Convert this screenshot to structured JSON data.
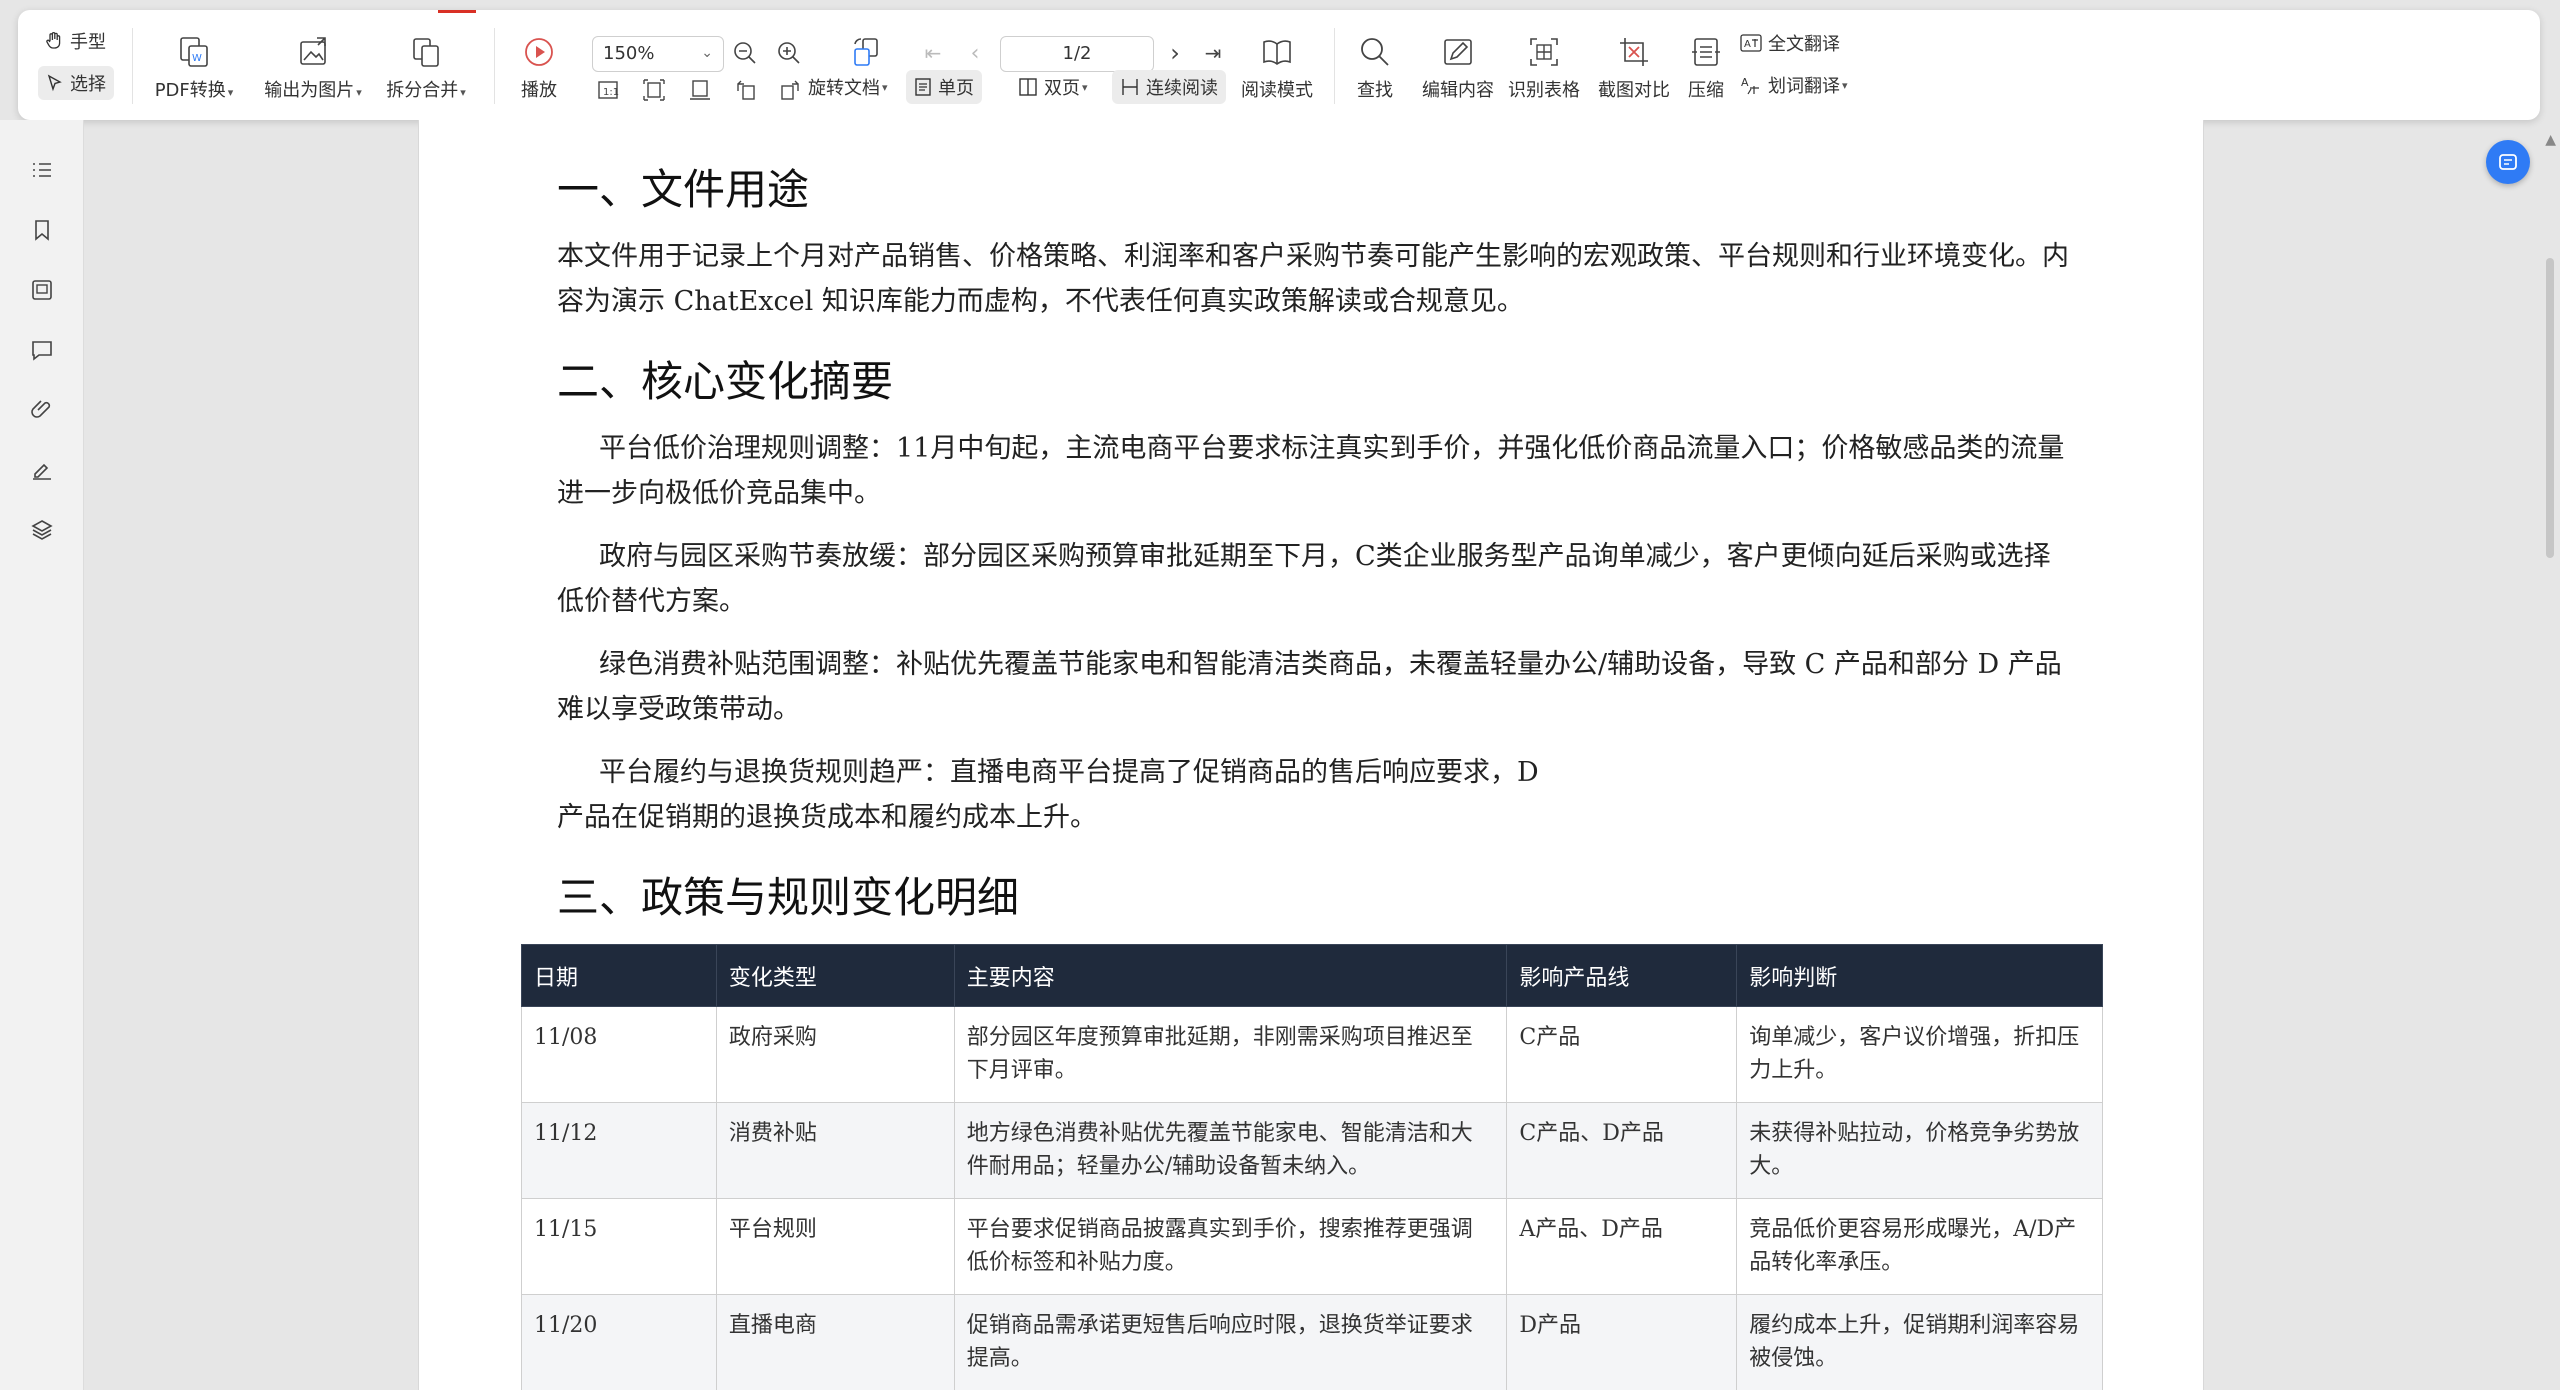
{
  "toolbar": {
    "hand_label": "手型",
    "select_label": "选择",
    "pdf_convert_label": "PDF转换",
    "export_image_label": "输出为图片",
    "split_merge_label": "拆分合并",
    "play_label": "播放",
    "zoom_value": "150%",
    "page_value": "1/2",
    "rotate_label": "旋转文档",
    "single_page_label": "单页",
    "double_page_label": "双页",
    "continuous_label": "连续阅读",
    "read_mode_label": "阅读模式",
    "find_label": "查找",
    "edit_content_label": "编辑内容",
    "recognize_table_label": "识别表格",
    "screenshot_compare_label": "截图对比",
    "compress_label": "压缩",
    "full_translate_label": "全文翻译",
    "word_translate_label": "划词翻译"
  },
  "colors": {
    "accent": "#2f7bf5",
    "table_header": "#1f2a3c",
    "active_pill": "#ececec"
  },
  "doc": {
    "section1_title": "一、文件用途",
    "section1_para": "本文件用于记录上个月对产品销售、价格策略、利润率和客户采购节奏可能产生影响的宏观政策、平台规则和行业环境变化。内容为演示 ChatExcel 知识库能力而虚构，不代表任何真实政策解读或合规意见。",
    "section2_title": "二、核心变化摘要",
    "section2_items": [
      "平台低价治理规则调整：11月中旬起，主流电商平台要求标注真实到手价，并强化低价商品流量入口；价格敏感品类的流量进一步向极低价竞品集中。",
      "政府与园区采购节奏放缓：部分园区采购预算审批延期至下月，C类企业服务型产品询单减少，客户更倾向延后采购或选择低价替代方案。",
      "绿色消费补贴范围调整：补贴优先覆盖节能家电和智能清洁类商品，未覆盖轻量办公/辅助设备，导致 C 产品和部分 D 产品难以享受政策带动。",
      "平台履约与退换货规则趋严：直播电商平台提高了促销商品的售后响应要求，D"
    ],
    "section2_item4_line2": "产品在促销期的退换货成本和履约成本上升。",
    "section3_title": "三、政策与规则变化明细",
    "table": {
      "headers": [
        "日期",
        "变化类型",
        "主要内容",
        "影响产品线",
        "影响判断"
      ],
      "rows": [
        [
          "11/08",
          "政府采购",
          "部分园区年度预算审批延期，非刚需采购项目推迟至下月评审。",
          "C产品",
          "询单减少，客户议价增强，折扣压力上升。"
        ],
        [
          "11/12",
          "消费补贴",
          "地方绿色消费补贴优先覆盖节能家电、智能清洁和大件耐用品；轻量办公/辅助设备暂未纳入。",
          "C产品、D产品",
          "未获得补贴拉动，价格竞争劣势放大。"
        ],
        [
          "11/15",
          "平台规则",
          "平台要求促销商品披露真实到手价，搜索推荐更强调低价标签和补贴力度。",
          "A产品、D产品",
          "竞品低价更容易形成曝光，A/D产品转化率承压。"
        ],
        [
          "11/20",
          "直播电商",
          "促销商品需承诺更短售后响应时限，退换货举证要求提高。",
          "D产品",
          "履约成本上升，促销期利润率容易被侵蚀。"
        ]
      ]
    }
  }
}
